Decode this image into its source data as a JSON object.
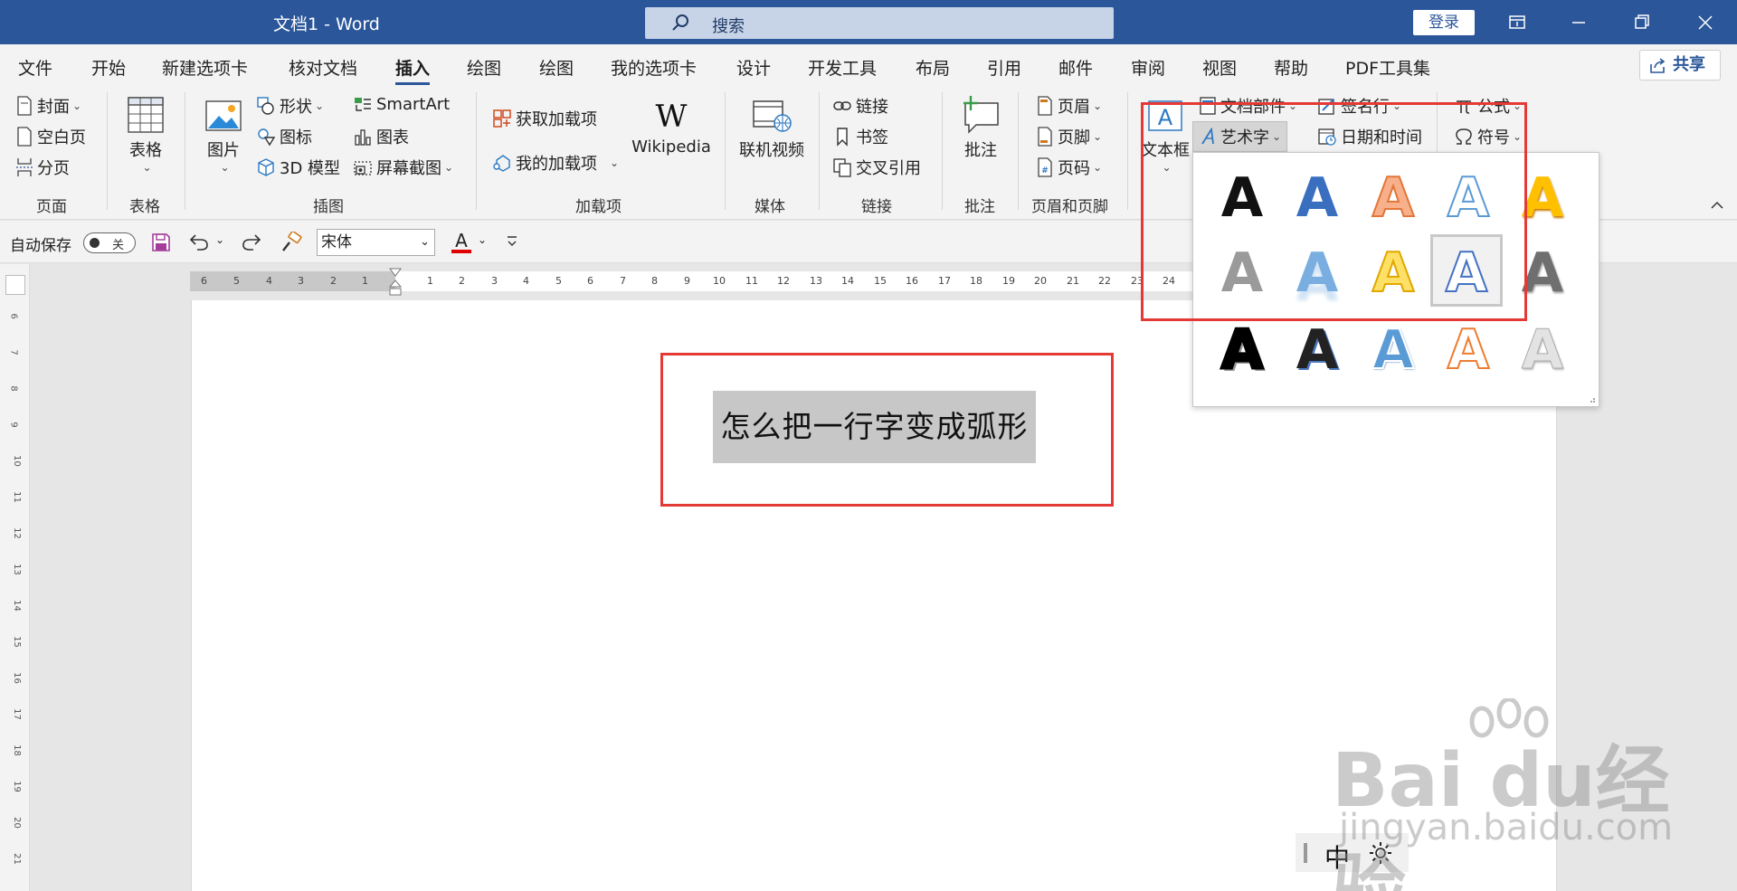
{
  "window": {
    "title": "文档1  -  Word",
    "search_placeholder": "搜索",
    "login_label": "登录"
  },
  "tabs": [
    {
      "label": "文件"
    },
    {
      "label": "开始"
    },
    {
      "label": "新建选项卡"
    },
    {
      "label": "核对文档"
    },
    {
      "label": "插入",
      "active": true
    },
    {
      "label": "绘图"
    },
    {
      "label": "绘图"
    },
    {
      "label": "我的选项卡"
    },
    {
      "label": "设计"
    },
    {
      "label": "开发工具"
    },
    {
      "label": "布局"
    },
    {
      "label": "引用"
    },
    {
      "label": "邮件"
    },
    {
      "label": "审阅"
    },
    {
      "label": "视图"
    },
    {
      "label": "帮助"
    },
    {
      "label": "PDF工具集"
    }
  ],
  "share_label": "共享",
  "ribbon": {
    "pages": {
      "cover": "封面",
      "blank": "空白页",
      "break": "分页",
      "group": "页面"
    },
    "tables": {
      "table": "表格",
      "group": "表格"
    },
    "illustrations": {
      "picture": "图片",
      "shapes": "形状",
      "icons": "图标",
      "model3d": "3D 模型",
      "smartart": "SmartArt",
      "chart": "图表",
      "screenshot": "屏幕截图",
      "group": "插图"
    },
    "addins": {
      "get": "获取加载项",
      "my": "我的加载项",
      "wikipedia": "Wikipedia",
      "group": "加载项"
    },
    "media": {
      "video": "联机视频",
      "group": "媒体"
    },
    "links": {
      "link": "链接",
      "bookmark": "书签",
      "crossref": "交叉引用",
      "group": "链接"
    },
    "comments": {
      "comment": "批注",
      "group": "批注"
    },
    "headerfooter": {
      "header": "页眉",
      "footer": "页脚",
      "pagenum": "页码",
      "group": "页眉和页脚"
    },
    "text": {
      "textbox": "文本框",
      "quickparts": "文档部件",
      "wordart": "艺术字",
      "signature": "签名行",
      "datetime": "日期和时间"
    },
    "symbols": {
      "equation": "公式",
      "symbol": "符号"
    }
  },
  "qat": {
    "autosave": "自动保存",
    "toggle_state": "关",
    "font": "宋体"
  },
  "ruler": {
    "h_left": [
      "6",
      "5",
      "4",
      "3",
      "2",
      "1"
    ],
    "h_right": [
      "1",
      "2",
      "3",
      "4",
      "5",
      "6",
      "7",
      "8",
      "9",
      "10",
      "11",
      "12",
      "13",
      "14",
      "15",
      "16",
      "17",
      "18",
      "19",
      "20",
      "21",
      "22",
      "23",
      "24"
    ],
    "v": [
      "6",
      "7",
      "8",
      "9",
      "10",
      "11",
      "12",
      "13",
      "14",
      "15",
      "16",
      "17",
      "18",
      "19",
      "20",
      "21"
    ]
  },
  "document": {
    "selected_text": "怎么把一行字变成弧形"
  },
  "wordart_gallery": {
    "items": [
      {
        "name": "wordart-style-1",
        "glyph": "A"
      },
      {
        "name": "wordart-style-2",
        "glyph": "A"
      },
      {
        "name": "wordart-style-3",
        "glyph": "A"
      },
      {
        "name": "wordart-style-4",
        "glyph": "A"
      },
      {
        "name": "wordart-style-5",
        "glyph": "A"
      },
      {
        "name": "wordart-style-6",
        "glyph": "A"
      },
      {
        "name": "wordart-style-7",
        "glyph": "A"
      },
      {
        "name": "wordart-style-8",
        "glyph": "A"
      },
      {
        "name": "wordart-style-9",
        "glyph": "A",
        "selected": true
      },
      {
        "name": "wordart-style-10",
        "glyph": "A"
      },
      {
        "name": "wordart-style-11",
        "glyph": "A"
      },
      {
        "name": "wordart-style-12",
        "glyph": "A"
      },
      {
        "name": "wordart-style-13",
        "glyph": "A"
      },
      {
        "name": "wordart-style-14",
        "glyph": "A"
      },
      {
        "name": "wordart-style-15",
        "glyph": "A"
      }
    ]
  },
  "ime": {
    "mode": "中"
  },
  "watermark": {
    "line1": "Bai du经验",
    "line2": "jingyan.baidu.com"
  },
  "colors": {
    "title_bar": "#2b579a",
    "highlight": "#e53935",
    "font_color_underline": "#e00000"
  }
}
